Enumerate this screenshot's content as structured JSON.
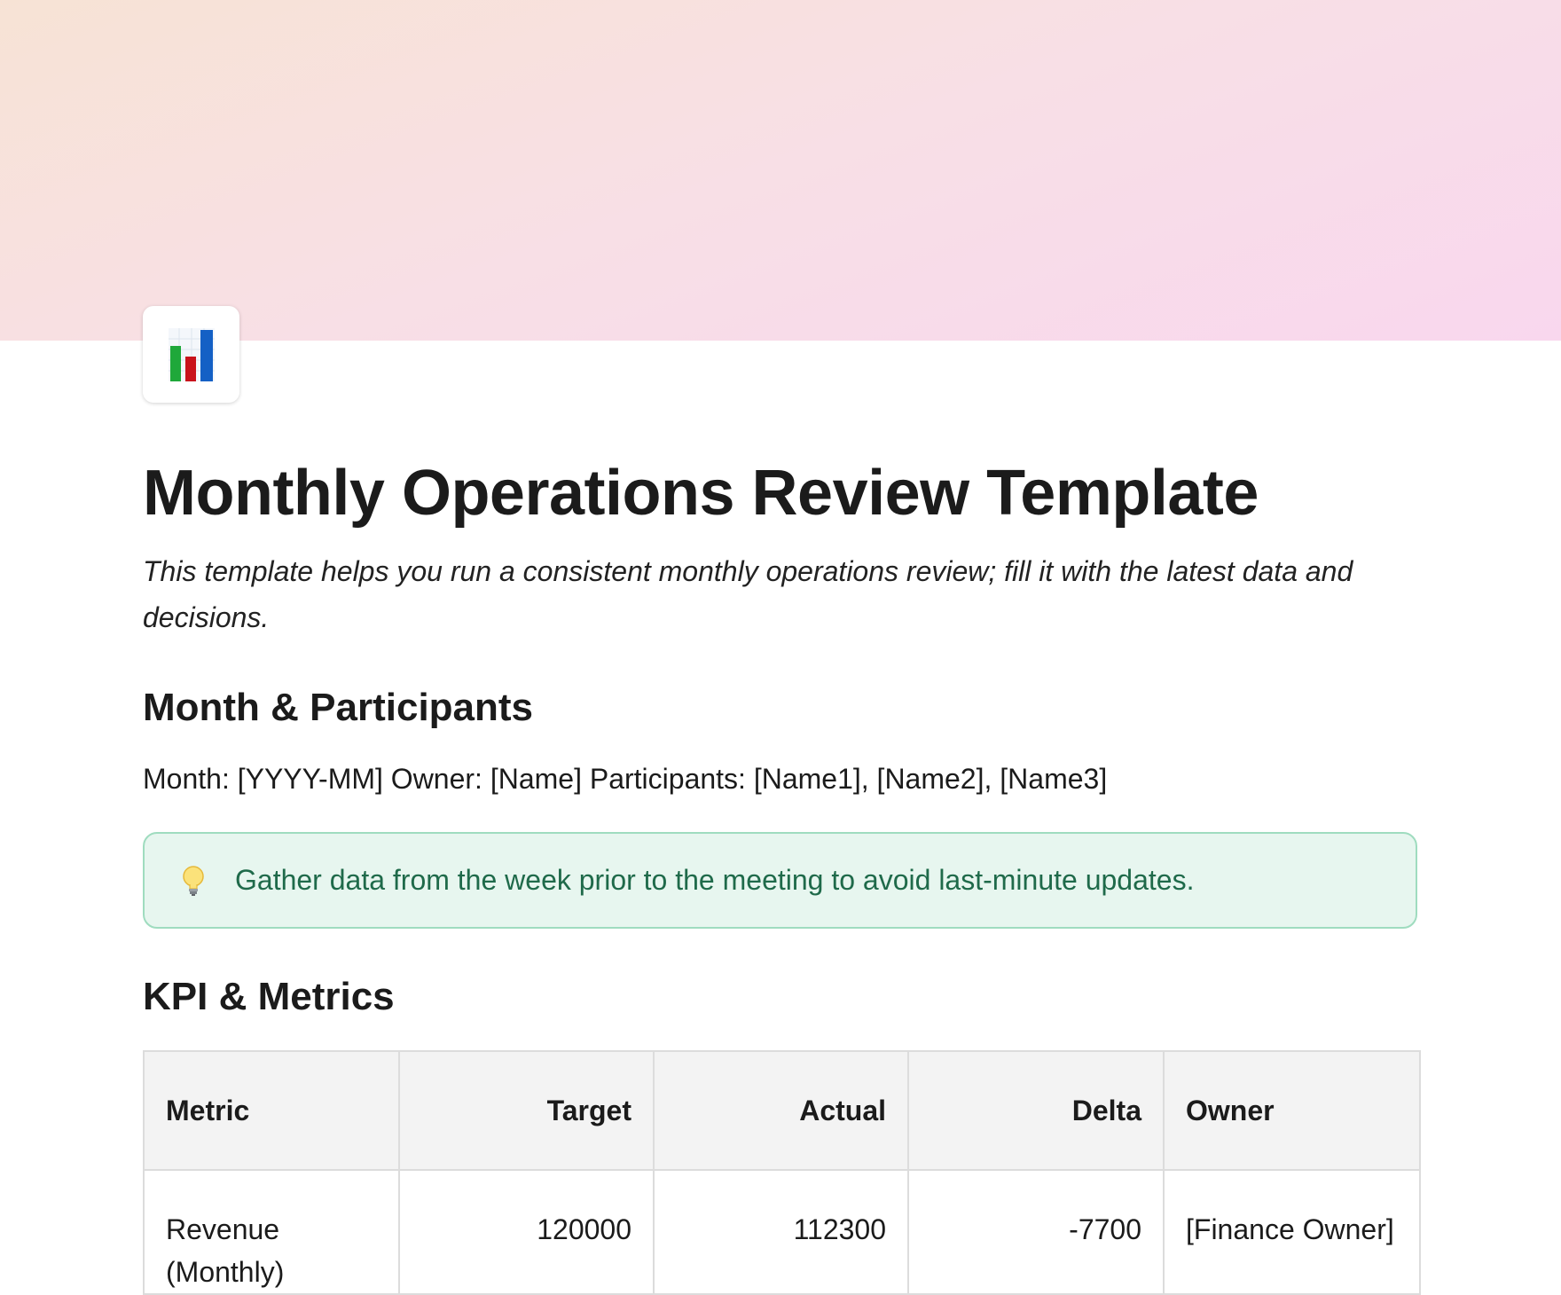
{
  "page": {
    "title": "Monthly Operations Review Template",
    "subtitle": "This template helps you run a consistent monthly operations review; fill it with the latest data and decisions.",
    "icon": "bar-chart-icon"
  },
  "sections": {
    "month_heading": "Month & Participants",
    "month_line": "Month: [YYYY-MM] Owner: [Name] Participants: [Name1], [Name2], [Name3]",
    "callout": {
      "icon": "lightbulb-icon",
      "text": "Gather data from the week prior to the meeting to avoid last-minute updates."
    },
    "kpi_heading": "KPI & Metrics"
  },
  "kpi_table": {
    "headers": [
      "Metric",
      "Target",
      "Actual",
      "Delta",
      "Owner"
    ],
    "rows": [
      {
        "metric": "Revenue (Monthly)",
        "target": "120000",
        "actual": "112300",
        "delta": "-7700",
        "owner": "[Finance Owner]"
      }
    ]
  },
  "colors": {
    "cover_start": "#f7e3d5",
    "cover_end": "#f9d7ee",
    "callout_bg": "#e7f6ef",
    "callout_border": "#9fdcbf",
    "callout_text": "#1f6a4a"
  }
}
